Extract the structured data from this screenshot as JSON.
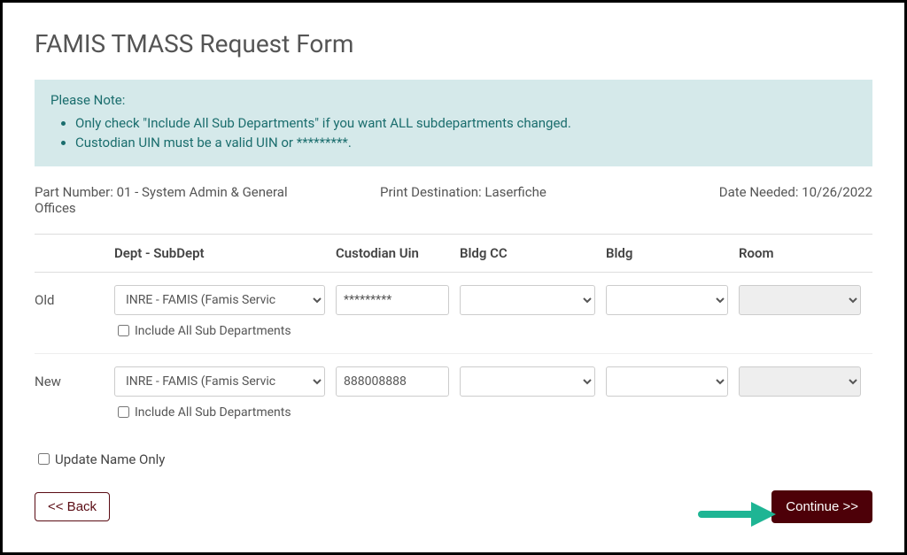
{
  "page_title": "FAMIS TMASS Request Form",
  "note": {
    "heading": "Please Note:",
    "items": [
      "Only check \"Include All Sub Departments\" if you want ALL subdepartments changed.",
      "Custodian UIN must be a valid UIN or *********."
    ]
  },
  "info": {
    "part_label": "Part Number: ",
    "part_value": "01 - System Admin & General Offices",
    "print_label": "Print Destination: ",
    "print_value": "Laserfiche",
    "date_label": "Date Needed: ",
    "date_value": "10/26/2022"
  },
  "headers": {
    "dept": "Dept - SubDept",
    "uin": "Custodian Uin",
    "bldgcc": "Bldg CC",
    "bldg": "Bldg",
    "room": "Room"
  },
  "rows": {
    "old": {
      "label": "Old",
      "dept_selected": "INRE - FAMIS (Famis Servic",
      "uin_value": "*********",
      "include_label": "Include All Sub Departments"
    },
    "new": {
      "label": "New",
      "dept_selected": "INRE - FAMIS (Famis Servic",
      "uin_value": "888008888",
      "include_label": "Include All Sub Departments"
    }
  },
  "update_only_label": "Update Name Only",
  "buttons": {
    "back": "<< Back",
    "continue": "Continue >>"
  }
}
